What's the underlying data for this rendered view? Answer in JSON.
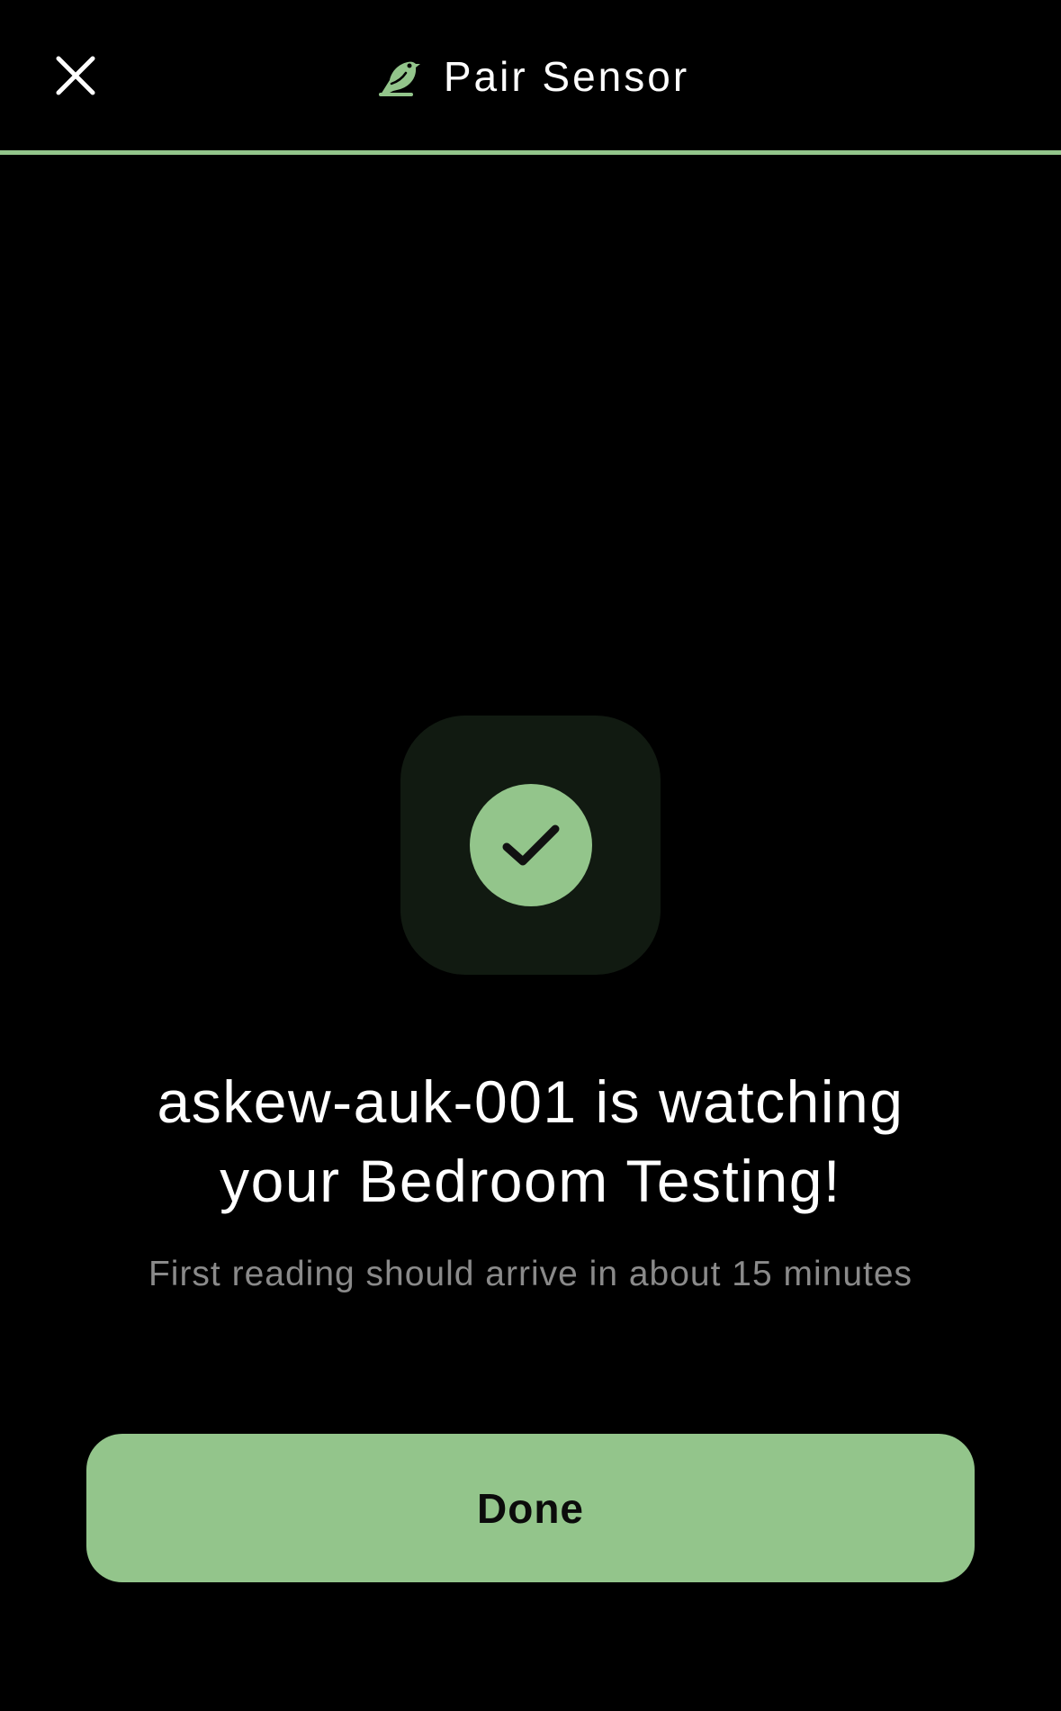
{
  "header": {
    "title": "Pair Sensor",
    "close_icon": "close-icon",
    "brand_icon": "bird-icon"
  },
  "progress": {
    "fraction": 1.0
  },
  "status": {
    "icon": "check-circle-icon",
    "message_line1": "askew-auk-001 is watching",
    "message_line2": "your Bedroom Testing!",
    "subtext": "First reading should arrive in about 15 minutes"
  },
  "actions": {
    "done_label": "Done"
  },
  "colors": {
    "accent": "#93c58b",
    "background": "#000000",
    "tile": "#111a11",
    "subtext": "#8a8a8a"
  }
}
